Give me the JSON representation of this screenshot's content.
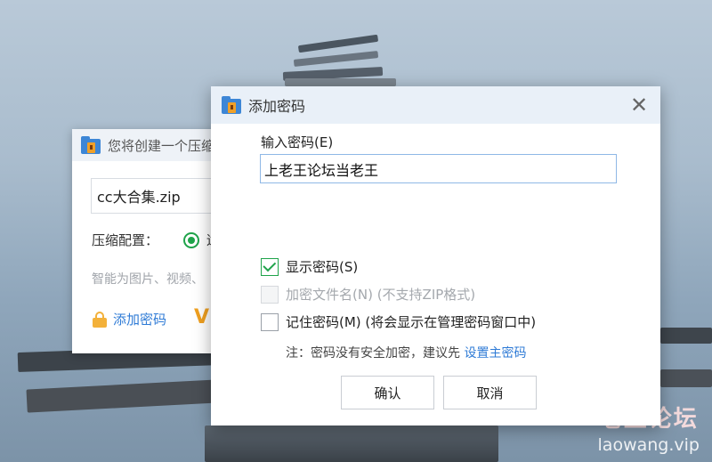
{
  "watermark": {
    "line1": "老王论坛",
    "line2": "laowang.vip"
  },
  "bg_window": {
    "title": "您将创建一个压缩",
    "filename": "cc大合集.zip",
    "config_label": "压缩配置：",
    "config_option_partial": "适",
    "gray_text": "智能为图片、视频、",
    "add_password_link": "添加密码"
  },
  "dialog": {
    "title": "添加密码",
    "password_label": "输入密码(E)",
    "password_value": "上老王论坛当老王",
    "show_password": {
      "label": "显示密码(S)",
      "checked": true
    },
    "encrypt_filenames": {
      "label": "加密文件名(N) (不支持ZIP格式)",
      "disabled": true
    },
    "remember_password": {
      "label": "记住密码(M) (将会显示在管理密码窗口中)",
      "checked": false
    },
    "note_prefix": "注：密码没有安全加密，建议先 ",
    "note_link": "设置主密码",
    "ok_button": "确认",
    "cancel_button": "取消",
    "close_glyph": "✕"
  },
  "colors": {
    "accent_green": "#1fa34a",
    "link_blue": "#2f7bd6",
    "title_bar": "#e9f0f8"
  },
  "icons": [
    "zip-archive-icon",
    "lock-icon",
    "close-icon",
    "checkmark-icon",
    "v-logo-icon"
  ]
}
